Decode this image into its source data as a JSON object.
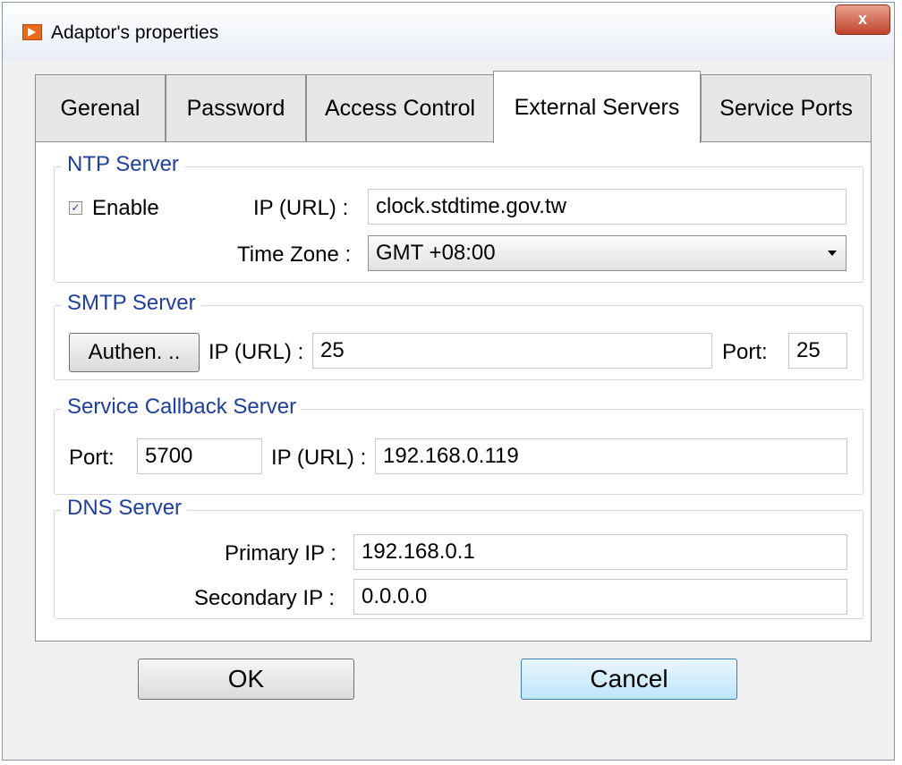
{
  "window": {
    "title": "Adaptor's properties",
    "close_label": "x"
  },
  "tabs": [
    {
      "label": "Gerenal"
    },
    {
      "label": "Password"
    },
    {
      "label": "Access Control"
    },
    {
      "label": "External Servers"
    },
    {
      "label": "Service Ports"
    }
  ],
  "ntp": {
    "title": "NTP Server",
    "enable_label": "Enable",
    "enabled": true,
    "ip_label": "IP (URL) :",
    "ip_value": "clock.stdtime.gov.tw",
    "tz_label": "Time Zone :",
    "tz_value": "GMT +08:00"
  },
  "smtp": {
    "title": "SMTP Server",
    "auth_label": "Authen. ..",
    "ip_label": "IP (URL) :",
    "ip_value": "25",
    "port_label": "Port:",
    "port_value": "25"
  },
  "callback": {
    "title": "Service Callback Server",
    "port_label": "Port:",
    "port_value": "5700",
    "ip_label": "IP (URL) :",
    "ip_value": "192.168.0.119"
  },
  "dns": {
    "title": "DNS Server",
    "primary_label": "Primary IP :",
    "primary_value": "192.168.0.1",
    "secondary_label": "Secondary IP :",
    "secondary_value": "0.0.0.0"
  },
  "buttons": {
    "ok": "OK",
    "cancel": "Cancel"
  }
}
